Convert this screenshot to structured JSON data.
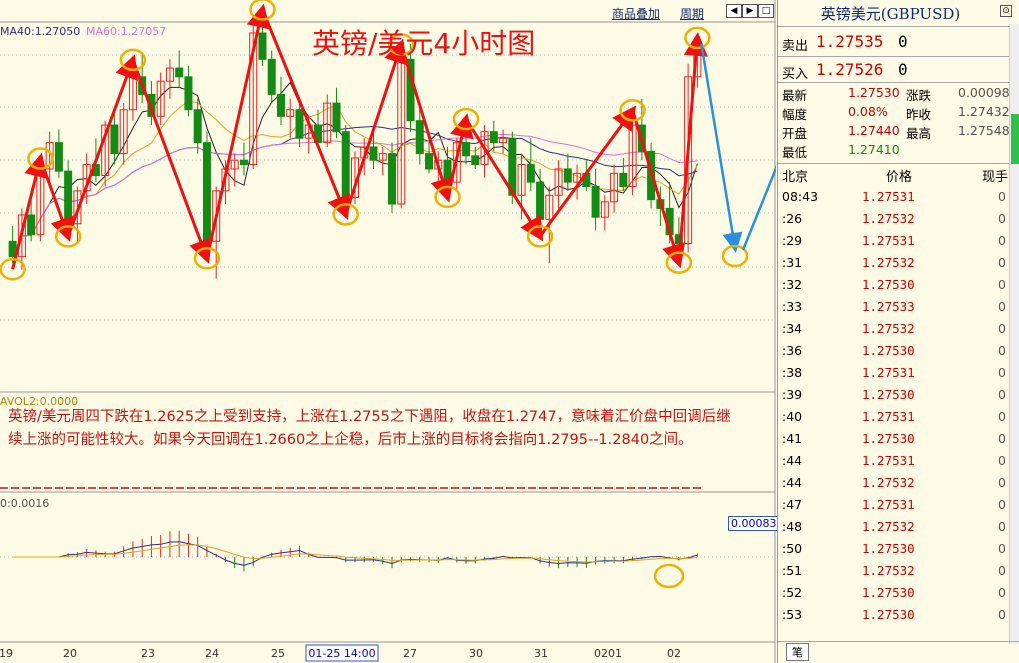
{
  "toolbar": {
    "overlay_label": "商品叠加",
    "period_label": "周期"
  },
  "chart_title": "英镑/美元4小时图",
  "legend": {
    "ma40": "MA40:1.27050",
    "ma60": "MA60:1.27057",
    "vol": "AVOL2:0.0000",
    "macd": "0:0.0016",
    "macd_value": "0.00083"
  },
  "note": "英镑/美元周四下跌在1.2625之上受到支持，上涨在1.2755之下遇阻，收盘在1.2747，意味着汇价盘中回调后继续上涨的可能性较大。如果今天回调在1.2660之上企稳，后市上涨的目标将会指向1.2795--1.2840之间。",
  "panel": {
    "title": "英镑美元(GBPUSD)",
    "sell_label": "卖出",
    "sell_price": "1.27535",
    "sell_vol": "0",
    "buy_label": "买入",
    "buy_price": "1.27526",
    "buy_vol": "0",
    "stats": [
      {
        "l1": "最新",
        "v1": "1.27530",
        "l2": "涨跌",
        "v2": "0.00098"
      },
      {
        "l1": "幅度",
        "v1": "0.08%",
        "l2": "昨收",
        "v2": "1.27432"
      },
      {
        "l1": "开盘",
        "v1": "1.27440",
        "l2": "最高",
        "v2": "1.27548"
      },
      {
        "l1": "最低",
        "v1": "1.27410",
        "l2": "",
        "v2": ""
      }
    ],
    "head_time": "北京",
    "head_price": "价格",
    "head_vol": "现手",
    "ticks": [
      {
        "t": "08:43",
        "p": "1.27531",
        "v": "0"
      },
      {
        "t": ":26",
        "p": "1.27532",
        "v": "0"
      },
      {
        "t": ":29",
        "p": "1.27531",
        "v": "0"
      },
      {
        "t": ":31",
        "p": "1.27532",
        "v": "0"
      },
      {
        "t": ":32",
        "p": "1.27530",
        "v": "0"
      },
      {
        "t": ":33",
        "p": "1.27533",
        "v": "0"
      },
      {
        "t": ":34",
        "p": "1.27532",
        "v": "0"
      },
      {
        "t": ":36",
        "p": "1.27530",
        "v": "0"
      },
      {
        "t": ":38",
        "p": "1.27531",
        "v": "0"
      },
      {
        "t": ":39",
        "p": "1.27530",
        "v": "0"
      },
      {
        "t": ":40",
        "p": "1.27531",
        "v": "0"
      },
      {
        "t": ":41",
        "p": "1.27530",
        "v": "0"
      },
      {
        "t": ":44",
        "p": "1.27531",
        "v": "0"
      },
      {
        "t": ":44",
        "p": "1.27532",
        "v": "0"
      },
      {
        "t": ":47",
        "p": "1.27531",
        "v": "0"
      },
      {
        "t": ":48",
        "p": "1.27532",
        "v": "0"
      },
      {
        "t": ":50",
        "p": "1.27530",
        "v": "0"
      },
      {
        "t": ":51",
        "p": "1.27532",
        "v": "0"
      },
      {
        "t": ":52",
        "p": "1.27530",
        "v": "0"
      },
      {
        "t": ":53",
        "p": "1.27530",
        "v": "0"
      }
    ],
    "pen_tab": "笔"
  },
  "colors": {
    "up": "#ee2222",
    "down": "#158a15",
    "arrow": "#ee1111",
    "forecast": "#2a8fe0",
    "circle": "#f0b000",
    "ma_fast": "#222222",
    "ma_mid": "#e8a020",
    "ma_slow": "#303080",
    "ma_pink": "#e070d0"
  },
  "chart_data": {
    "type": "candlestick",
    "title": "英镑/美元4小时图",
    "x_tick_labels": [
      "19",
      "20",
      "23",
      "24",
      "25",
      "01-25 14:00",
      "27",
      "30",
      "31",
      "0201",
      "02"
    ],
    "y_range": [
      1.262,
      1.2765
    ],
    "candles": [
      [
        1.2665,
        1.2672,
        1.2655,
        1.2658
      ],
      [
        1.2658,
        1.268,
        1.2652,
        1.2677
      ],
      [
        1.2677,
        1.2688,
        1.2665,
        1.2668
      ],
      [
        1.2668,
        1.27,
        1.2665,
        1.2698
      ],
      [
        1.2698,
        1.2715,
        1.269,
        1.271
      ],
      [
        1.271,
        1.2716,
        1.2694,
        1.2697
      ],
      [
        1.2697,
        1.2702,
        1.267,
        1.2673
      ],
      [
        1.2673,
        1.269,
        1.2664,
        1.2688
      ],
      [
        1.2688,
        1.2705,
        1.2682,
        1.27
      ],
      [
        1.27,
        1.2712,
        1.2692,
        1.2695
      ],
      [
        1.2695,
        1.272,
        1.269,
        1.2718
      ],
      [
        1.2718,
        1.2725,
        1.27,
        1.2705
      ],
      [
        1.2705,
        1.2728,
        1.27,
        1.2725
      ],
      [
        1.2725,
        1.2745,
        1.272,
        1.274
      ],
      [
        1.274,
        1.275,
        1.2728,
        1.2732
      ],
      [
        1.2732,
        1.2738,
        1.2718,
        1.2722
      ],
      [
        1.2722,
        1.2742,
        1.2718,
        1.2738
      ],
      [
        1.2738,
        1.2748,
        1.273,
        1.2744
      ],
      [
        1.2744,
        1.2752,
        1.2735,
        1.274
      ],
      [
        1.274,
        1.2745,
        1.2722,
        1.2725
      ],
      [
        1.2725,
        1.273,
        1.2705,
        1.271
      ],
      [
        1.271,
        1.2715,
        1.266,
        1.2665
      ],
      [
        1.2665,
        1.269,
        1.2648,
        1.2688
      ],
      [
        1.2688,
        1.2702,
        1.2682,
        1.2698
      ],
      [
        1.2698,
        1.2705,
        1.269,
        1.2702
      ],
      [
        1.2702,
        1.271,
        1.2695,
        1.27
      ],
      [
        1.27,
        1.2765,
        1.2698,
        1.276
      ],
      [
        1.276,
        1.2768,
        1.2745,
        1.2748
      ],
      [
        1.2748,
        1.2752,
        1.2728,
        1.2732
      ],
      [
        1.2732,
        1.274,
        1.2718,
        1.2722
      ],
      [
        1.2722,
        1.273,
        1.2712,
        1.2725
      ],
      [
        1.2725,
        1.2728,
        1.2708,
        1.2712
      ],
      [
        1.2712,
        1.2722,
        1.2705,
        1.2718
      ],
      [
        1.2718,
        1.2725,
        1.2708,
        1.271
      ],
      [
        1.271,
        1.2732,
        1.2708,
        1.2728
      ],
      [
        1.2728,
        1.2735,
        1.2712,
        1.2715
      ],
      [
        1.2715,
        1.2718,
        1.268,
        1.2685
      ],
      [
        1.2685,
        1.2706,
        1.2682,
        1.2703
      ],
      [
        1.2703,
        1.2712,
        1.2695,
        1.2708
      ],
      [
        1.2708,
        1.2715,
        1.2698,
        1.2702
      ],
      [
        1.2702,
        1.2708,
        1.2695,
        1.2705
      ],
      [
        1.2705,
        1.271,
        1.2678,
        1.2682
      ],
      [
        1.2682,
        1.2752,
        1.268,
        1.2748
      ],
      [
        1.2748,
        1.2755,
        1.2715,
        1.272
      ],
      [
        1.272,
        1.2728,
        1.27,
        1.2705
      ],
      [
        1.2705,
        1.2712,
        1.2696,
        1.2698
      ],
      [
        1.2698,
        1.2706,
        1.269,
        1.2702
      ],
      [
        1.2702,
        1.2708,
        1.2688,
        1.2692
      ],
      [
        1.2692,
        1.2712,
        1.2688,
        1.271
      ],
      [
        1.271,
        1.2718,
        1.27,
        1.2704
      ],
      [
        1.2704,
        1.2708,
        1.2698,
        1.27
      ],
      [
        1.27,
        1.2718,
        1.2694,
        1.2715
      ],
      [
        1.2715,
        1.272,
        1.2706,
        1.271
      ],
      [
        1.271,
        1.2716,
        1.2705,
        1.2712
      ],
      [
        1.2712,
        1.2715,
        1.2682,
        1.2686
      ],
      [
        1.2686,
        1.2705,
        1.2675,
        1.27
      ],
      [
        1.27,
        1.2712,
        1.2688,
        1.2692
      ],
      [
        1.2692,
        1.2698,
        1.267,
        1.2675
      ],
      [
        1.2675,
        1.269,
        1.2655,
        1.2686
      ],
      [
        1.2686,
        1.2702,
        1.268,
        1.2698
      ],
      [
        1.2698,
        1.2705,
        1.2688,
        1.2692
      ],
      [
        1.2692,
        1.27,
        1.2684,
        1.2696
      ],
      [
        1.2696,
        1.2702,
        1.2688,
        1.269
      ],
      [
        1.269,
        1.2698,
        1.267,
        1.2676
      ],
      [
        1.2676,
        1.2686,
        1.267,
        1.2683
      ],
      [
        1.2683,
        1.27,
        1.2678,
        1.2696
      ],
      [
        1.2696,
        1.2703,
        1.2688,
        1.269
      ],
      [
        1.269,
        1.2722,
        1.2686,
        1.2718
      ],
      [
        1.2718,
        1.273,
        1.2702,
        1.2706
      ],
      [
        1.2706,
        1.271,
        1.268,
        1.2684
      ],
      [
        1.2684,
        1.269,
        1.2672,
        1.268
      ],
      [
        1.268,
        1.2692,
        1.2664,
        1.2668
      ],
      [
        1.2668,
        1.2676,
        1.2658,
        1.2664
      ],
      [
        1.2664,
        1.2746,
        1.266,
        1.274
      ],
      [
        1.274,
        1.2755,
        1.2735,
        1.275
      ]
    ]
  }
}
